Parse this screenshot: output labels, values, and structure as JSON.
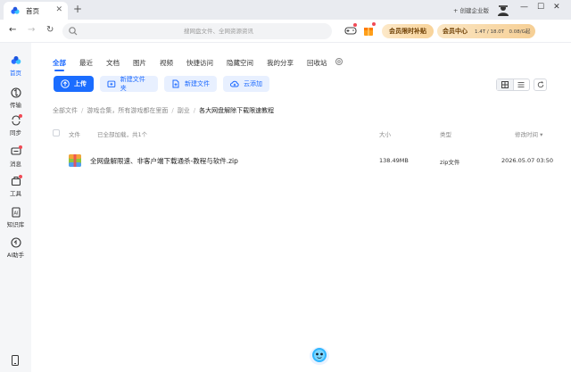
{
  "window": {
    "tab_title": "首页",
    "new_tab": "+",
    "create_enterprise": "+ 创建企业版",
    "controls": [
      "—",
      "☐",
      "✕"
    ]
  },
  "search": {
    "placeholder": "搜网盘文件、全网资源资讯"
  },
  "top_right": {
    "vip_bonus": "会员限时补贴",
    "vip_center": "会员中心",
    "quota": "1.4T / 18.0T",
    "speed": "0.08/G起"
  },
  "sidebar": {
    "items": [
      {
        "label": "首页",
        "icon": "home-icon",
        "active": true
      },
      {
        "label": "传输",
        "icon": "transfer-icon"
      },
      {
        "label": "同步",
        "icon": "sync-icon",
        "dot": true
      },
      {
        "label": "消息",
        "icon": "message-icon",
        "dot": true
      },
      {
        "label": "工具",
        "icon": "toolbox-icon",
        "dot": true
      },
      {
        "label": "知识库",
        "icon": "knowledge-icon"
      },
      {
        "label": "AI助手",
        "icon": "ai-assistant-icon"
      }
    ]
  },
  "tabs": [
    "全部",
    "最近",
    "文档",
    "图片",
    "视频",
    "快捷访问",
    "隐藏空间",
    "我的分享",
    "回收站"
  ],
  "actions": {
    "upload": "上传",
    "new_folder": "新建文件夹",
    "new_file": "新建文件",
    "cloud_add": "云添加"
  },
  "breadcrumb": [
    "全部文件",
    "游戏合集，所有游戏都在里面",
    "副业",
    "各大网盘解除下载限速教程"
  ],
  "table": {
    "col_file": "文件",
    "loaded_status": "已全部加载，共1个",
    "col_size": "大小",
    "col_type": "类型",
    "col_modified": "修改时间"
  },
  "files": [
    {
      "name": "全网盘解限速、非客户端下载通杀-教程与软件.zip",
      "size": "138.49MB",
      "type": "zip文件",
      "modified": "2026.05.07 03:50"
    }
  ],
  "colors": {
    "accent": "#1b6dff",
    "vip_gold": "#f8d39a",
    "badge_red": "#f04a55"
  }
}
